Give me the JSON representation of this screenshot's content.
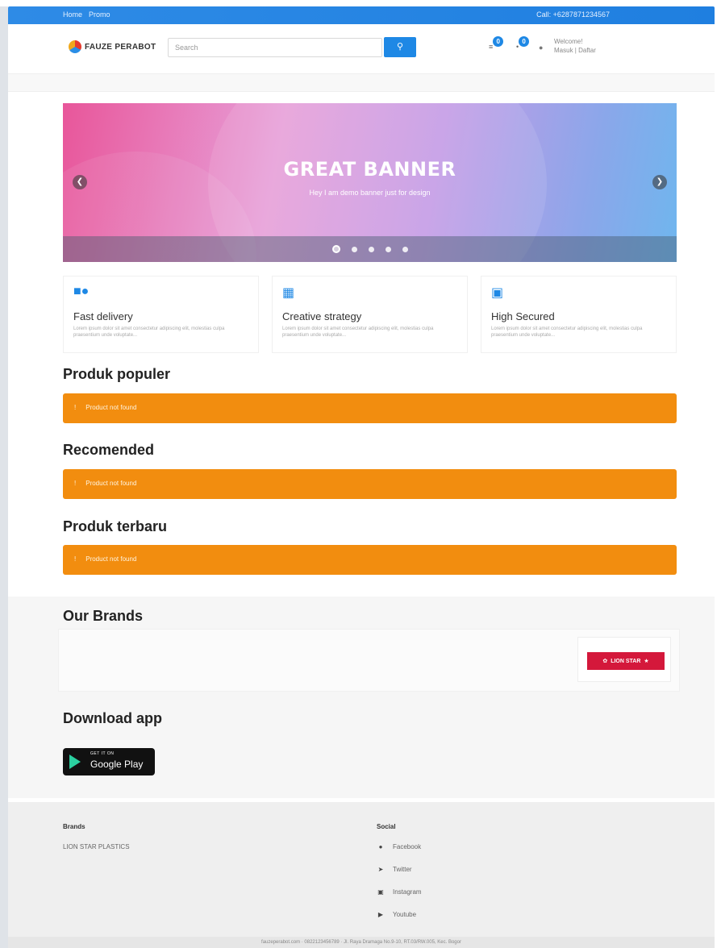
{
  "topbar": {
    "links": [
      "Home",
      "Promo"
    ],
    "contact": "Call: +6287871234567"
  },
  "header": {
    "logo_text": "FAUZE PERABOT",
    "search_placeholder": "Search",
    "search_button_icon": "search-icon",
    "cart_count": "0",
    "wishlist_count": "0",
    "welcome": "Welcome!",
    "auth_links": "Masuk | Daftar"
  },
  "banner": {
    "title": "GREAT BANNER",
    "subtitle": "Hey I am demo banner just for design",
    "slide_count": 5,
    "active_slide": 1
  },
  "features": [
    {
      "icon": "truck-icon",
      "title": "Fast delivery",
      "desc": "Lorem ipsum dolor sit amet consectetur adipiscing elit, molestias culpa praesentium unde voluptate..."
    },
    {
      "icon": "building-icon",
      "title": "Creative strategy",
      "desc": "Lorem ipsum dolor sit amet consectetur adipiscing elit, molestias culpa praesentium unde voluptate..."
    },
    {
      "icon": "lock-icon",
      "title": "High Secured",
      "desc": "Lorem ipsum dolor sit amet consectetur adipiscing elit, molestias culpa praesentium unde voluptate..."
    }
  ],
  "sections": [
    {
      "title": "Produk populer",
      "alert": "Product not found"
    },
    {
      "title": "Recomended",
      "alert": "Product not found"
    },
    {
      "title": "Produk terbaru",
      "alert": "Product not found"
    }
  ],
  "brands": {
    "title": "Our Brands",
    "logo_text": "LION STAR"
  },
  "download": {
    "title": "Download app",
    "badge_small": "GET IT ON",
    "badge_big": "Google Play"
  },
  "footer": {
    "brands_title": "Brands",
    "brands_item": "LION STAR PLASTICS",
    "social_title": "Social",
    "social": [
      {
        "icon": "facebook-icon",
        "label": "Facebook"
      },
      {
        "icon": "twitter-icon",
        "label": "Twitter"
      },
      {
        "icon": "instagram-icon",
        "label": "Instagram"
      },
      {
        "icon": "youtube-icon",
        "label": "Youtube"
      }
    ],
    "bottom_text": "fauzeperabot.com · 0822123456789 · Jl. Raya Dramaga No.9-10, RT.03/RW.005, Kec. Bogor"
  },
  "colors": {
    "primary": "#1e88e5",
    "alert": "#f28d0f",
    "brand_red": "#d4183b"
  }
}
